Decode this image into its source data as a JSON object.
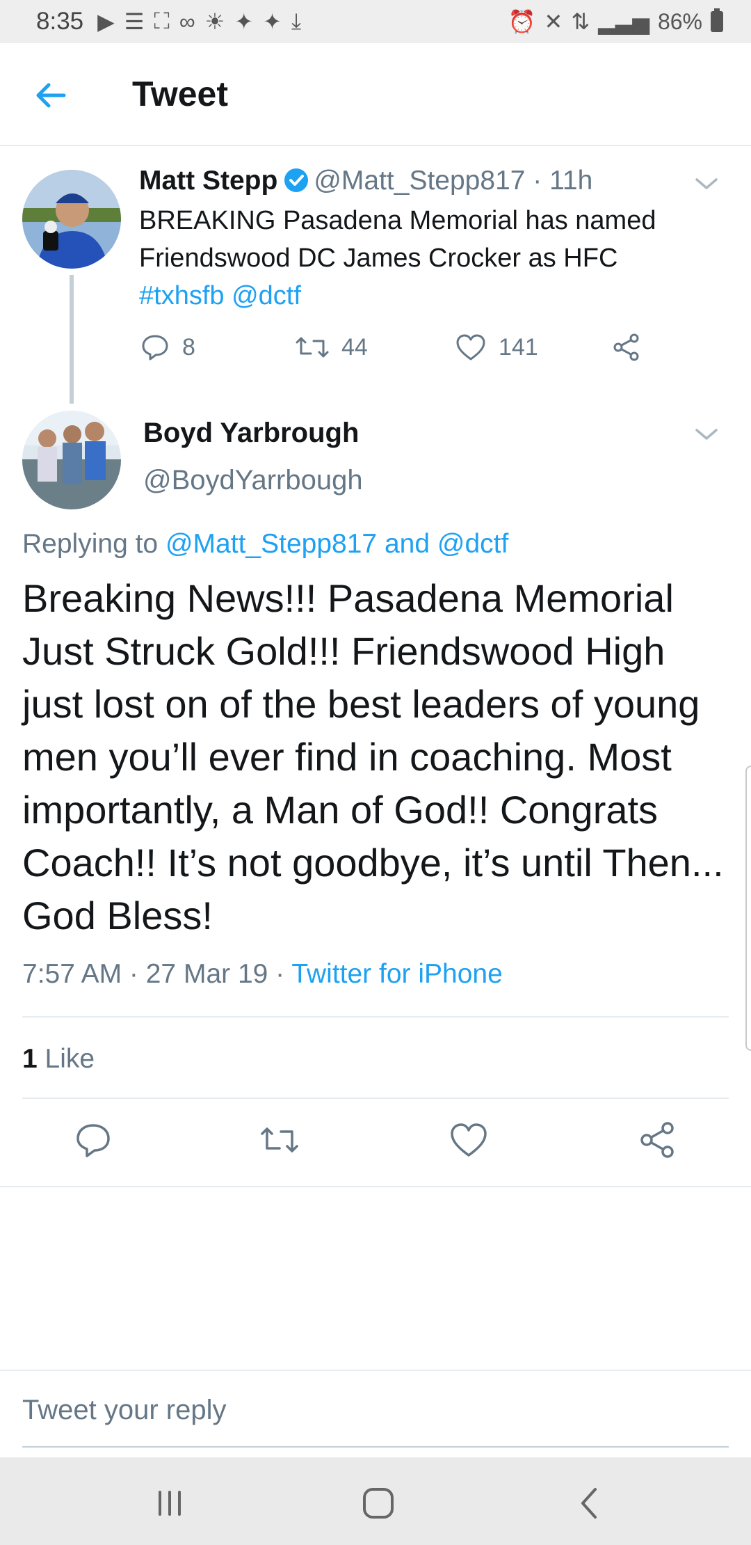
{
  "status_bar": {
    "time": "8:35",
    "battery": "86%"
  },
  "header": {
    "title": "Tweet"
  },
  "parent_tweet": {
    "name": "Matt Stepp",
    "handle": "@Matt_Stepp817",
    "time": "· 11h",
    "text_plain": "BREAKING Pasadena Memorial has named Friendswood DC James Crocker as HFC",
    "hashtag": "#txhsfb",
    "mention": "@dctf",
    "replies": "8",
    "retweets": "44",
    "likes": "141"
  },
  "reply_tweet": {
    "name": "Boyd Yarbrough",
    "handle": "@BoydYarrbough",
    "replying_prefix": "Replying to",
    "replying_to_1": "@Matt_Stepp817",
    "replying_and": "and",
    "replying_to_2": "@dctf",
    "text": "Breaking News!!! Pasadena Memorial Just Struck Gold!!! Friendswood High just lost on of the best leaders of young men you’ll ever find in coaching. Most importantly, a Man of God!! Congrats Coach!! It’s not goodbye, it’s until Then... God Bless!",
    "time": "7:57 AM · 27 Mar 19 ·",
    "source": "Twitter for iPhone",
    "like_count": "1",
    "like_label": "Like"
  },
  "composer": {
    "placeholder": "Tweet your reply"
  },
  "colors": {
    "accent": "#1da1f2",
    "secondary_text": "#657786",
    "divider": "#e6ecf0"
  }
}
